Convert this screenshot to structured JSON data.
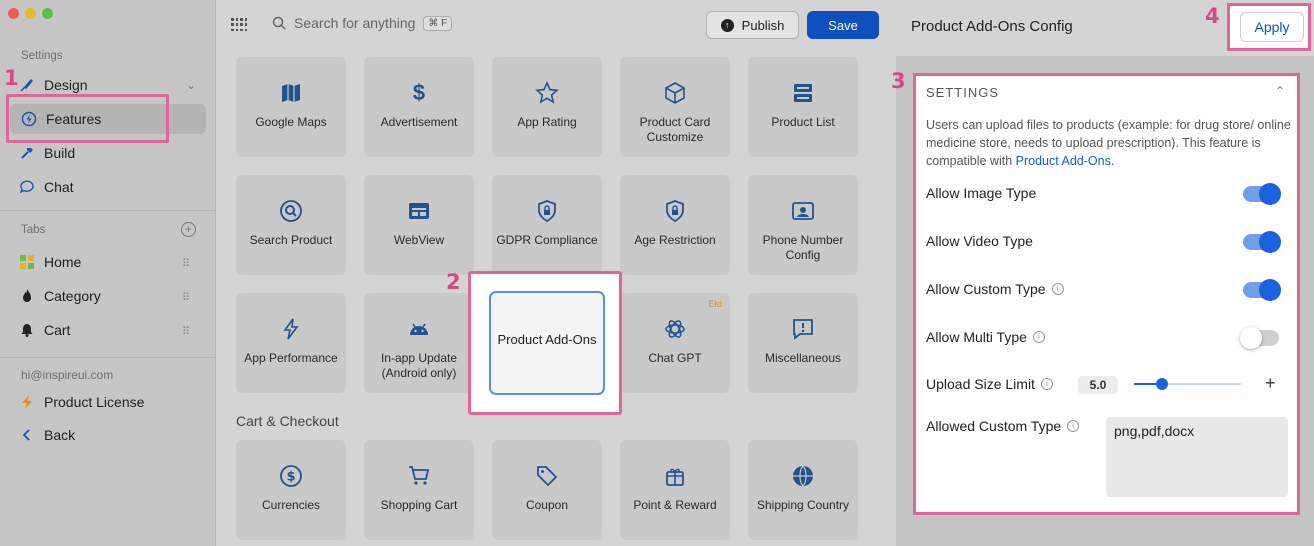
{
  "sidebar": {
    "settings_label": "Settings",
    "items": [
      {
        "label": "Design"
      },
      {
        "label": "Features"
      },
      {
        "label": "Build"
      },
      {
        "label": "Chat"
      }
    ],
    "tabs_label": "Tabs",
    "tabs": [
      {
        "label": "Home"
      },
      {
        "label": "Category"
      },
      {
        "label": "Cart"
      }
    ],
    "email": "hi@inspireui.com",
    "license_label": "Product License",
    "back_label": "Back"
  },
  "topbar": {
    "search_placeholder": "Search for anything",
    "shortcut": "⌘ F",
    "publish_label": "Publish",
    "save_label": "Save"
  },
  "features": [
    {
      "label": "Google Maps",
      "icon": "map-icon"
    },
    {
      "label": "Advertisement",
      "icon": "dollar-icon"
    },
    {
      "label": "App Rating",
      "icon": "star-icon"
    },
    {
      "label": "Product Card Customize",
      "icon": "cube-icon"
    },
    {
      "label": "Product List",
      "icon": "list-icon"
    },
    {
      "label": "Search Product",
      "icon": "search-icon"
    },
    {
      "label": "WebView",
      "icon": "browser-icon"
    },
    {
      "label": "GDPR Compliance",
      "icon": "shield-lock-icon"
    },
    {
      "label": "Age Restriction",
      "icon": "shield-lock-icon"
    },
    {
      "label": "Phone Number Config",
      "icon": "contact-card-icon"
    },
    {
      "label": "App Performance",
      "icon": "lightning-icon"
    },
    {
      "label": "In-app Update (Android only)",
      "icon": "android-icon"
    },
    {
      "label": "Product Add-Ons",
      "icon": "upload-icon"
    },
    {
      "label": "Chat GPT",
      "icon": "openai-icon",
      "badge": "Etd"
    },
    {
      "label": "Miscellaneous",
      "icon": "alert-bubble-icon"
    }
  ],
  "cart_section_title": "Cart & Checkout",
  "cart_features": [
    {
      "label": "Currencies",
      "icon": "currency-icon"
    },
    {
      "label": "Shopping Cart",
      "icon": "cart-icon"
    },
    {
      "label": "Coupon",
      "icon": "tag-icon"
    },
    {
      "label": "Point & Reward",
      "icon": "gift-icon"
    },
    {
      "label": "Shipping Country",
      "icon": "globe-icon"
    }
  ],
  "callouts": [
    "1",
    "2",
    "3",
    "4"
  ],
  "panel": {
    "title": "Product Add-Ons Config",
    "apply_label": "Apply",
    "settings_label": "SETTINGS",
    "description": "Users can upload files to products (example: for drug store/ online medicine store, needs to upload prescription). This feature is compatible with",
    "description_link": "Product Add-Ons.",
    "toggles": [
      {
        "label": "Allow Image Type",
        "on": true
      },
      {
        "label": "Allow Video Type",
        "on": true
      },
      {
        "label": "Allow Custom Type",
        "on": true
      },
      {
        "label": "Allow Multi Type",
        "on": false
      }
    ],
    "upload_limit_label": "Upload Size Limit",
    "upload_limit_value": "5.0",
    "custom_type_label": "Allowed Custom Type",
    "custom_type_value": "png,pdf,docx"
  },
  "colors": {
    "accent": "#0c4fbd",
    "highlight": "#e0669a",
    "toggle_on": "#1a63dc"
  }
}
